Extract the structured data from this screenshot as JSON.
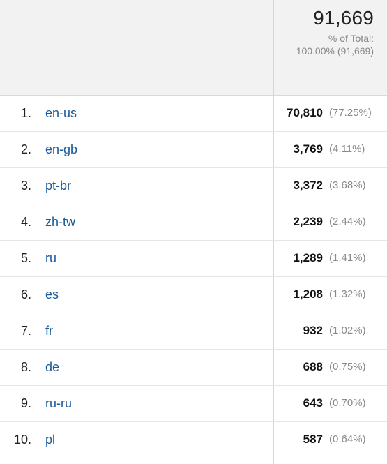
{
  "header": {
    "total_value": "91,669",
    "total_label": "% of Total:",
    "total_detail": "100.00% (91,669)"
  },
  "rows": [
    {
      "index": "1.",
      "label": "en-us",
      "value": "70,810",
      "pct": "(77.25%)"
    },
    {
      "index": "2.",
      "label": "en-gb",
      "value": "3,769",
      "pct": "(4.11%)"
    },
    {
      "index": "3.",
      "label": "pt-br",
      "value": "3,372",
      "pct": "(3.68%)"
    },
    {
      "index": "4.",
      "label": "zh-tw",
      "value": "2,239",
      "pct": "(2.44%)"
    },
    {
      "index": "5.",
      "label": "ru",
      "value": "1,289",
      "pct": "(1.41%)"
    },
    {
      "index": "6.",
      "label": "es",
      "value": "1,208",
      "pct": "(1.32%)"
    },
    {
      "index": "7.",
      "label": "fr",
      "value": "932",
      "pct": "(1.02%)"
    },
    {
      "index": "8.",
      "label": "de",
      "value": "688",
      "pct": "(0.75%)"
    },
    {
      "index": "9.",
      "label": "ru-ru",
      "value": "643",
      "pct": "(0.70%)"
    },
    {
      "index": "10.",
      "label": "pl",
      "value": "587",
      "pct": "(0.64%)"
    }
  ]
}
